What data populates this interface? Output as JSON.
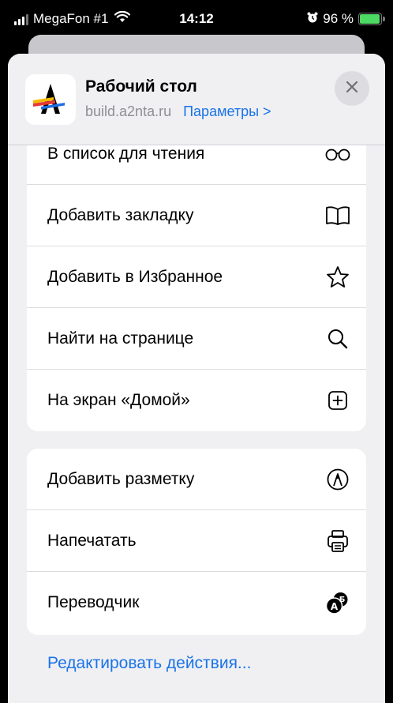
{
  "status_bar": {
    "carrier": "MegaFon #1",
    "time": "14:12",
    "battery": "96 %",
    "battery_level": 96
  },
  "header": {
    "title": "Рабочий стол",
    "domain": "build.a2nta.ru",
    "params_label": "Параметры >"
  },
  "groups": [
    {
      "items": [
        {
          "label": "В список для чтения",
          "icon": "glasses-icon"
        },
        {
          "label": "Добавить закладку",
          "icon": "book-icon"
        },
        {
          "label": "Добавить в Избранное",
          "icon": "star-icon"
        },
        {
          "label": "Найти на странице",
          "icon": "search-icon"
        },
        {
          "label": "На экран «Домой»",
          "icon": "add-square-icon"
        }
      ]
    },
    {
      "items": [
        {
          "label": "Добавить разметку",
          "icon": "markup-icon"
        },
        {
          "label": "Напечатать",
          "icon": "printer-icon"
        },
        {
          "label": "Переводчик",
          "icon": "translate-icon"
        }
      ]
    }
  ],
  "edit_actions_label": "Редактировать действия...",
  "colors": {
    "accent": "#1a73e8",
    "background": "#f0f0f3",
    "battery": "#4cd964"
  }
}
